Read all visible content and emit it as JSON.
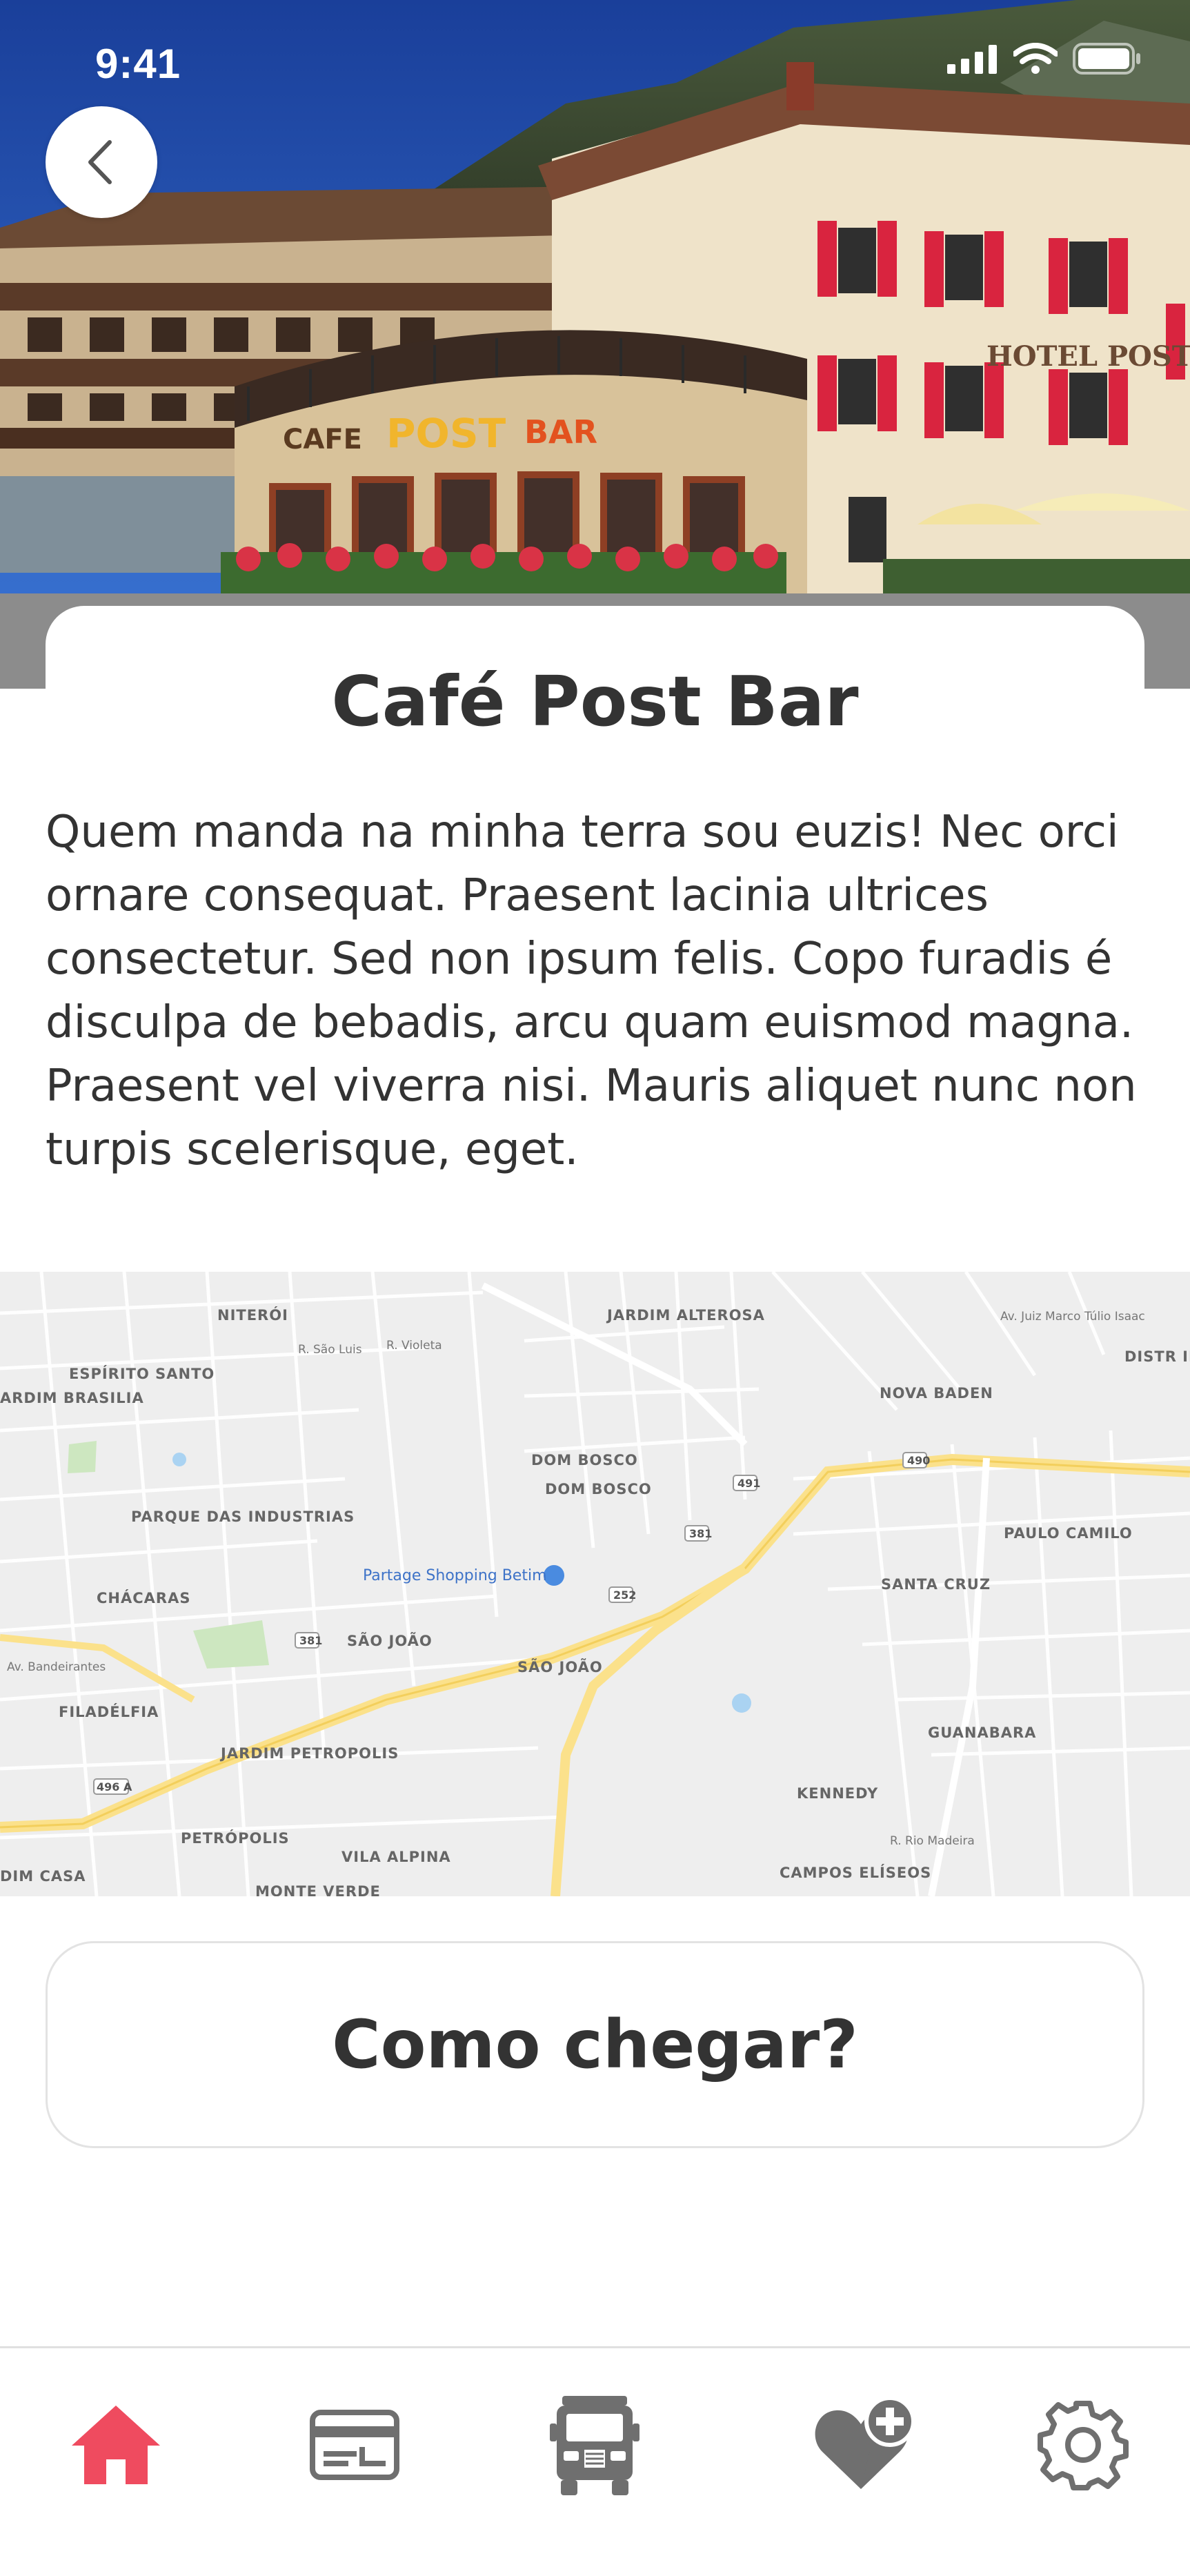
{
  "status_bar": {
    "time": "9:41",
    "icons": [
      "signal-icon",
      "wifi-icon",
      "battery-icon"
    ]
  },
  "header": {
    "back_icon": "chevron-left-icon"
  },
  "place": {
    "title": "Café Post Bar",
    "description": "Quem manda na minha terra sou euzis! Nec orci ornare consequat. Praesent lacinia ultrices consectetur. Sed non ipsum felis. Copo furadis é disculpa de bebadis, arcu quam euismod magna. Praesent vel viverra nisi. Mauris aliquet nunc non turpis scelerisque, eget.",
    "photo_signs": {
      "cafe_sign": "CAFE",
      "post_sign": "POST",
      "bar_sign": "BAR",
      "hotel_sign": "HOTEL POST"
    }
  },
  "map": {
    "labels": {
      "niteroi": "NITERÓI",
      "jardim_alterosa": "JARDIM ALTEROSA",
      "espirito_santo": "ESPÍRITO SANTO",
      "jardim_brasilia": "ARDIM BRASILIA",
      "nova_baden": "NOVA BADEN",
      "distr": "DISTR INDUST PAULO C NORT",
      "dom_bosco_1": "DOM BOSCO",
      "dom_bosco_2": "DOM BOSCO",
      "parque_industrias": "PARQUE DAS INDUSTRIAS",
      "paulo_camilo": "PAULO CAMILO",
      "partage": "Partage Shopping Betim",
      "santa_cruz": "SANTA CRUZ",
      "chacaras": "CHÁCARAS",
      "av_bandeirantes": "Av. Bandeirantes",
      "sao_joao_1": "SÃO JOÃO",
      "sao_joao_2": "SÃO JOÃO",
      "filadelfia": "FILADÉLFIA",
      "guanabara": "GUANABARA",
      "jardim_petropolis": "JARDIM PETROPOLIS",
      "kennedy": "KENNEDY",
      "petropolis": "PETRÓPOLIS",
      "vila_alpina": "VILA ALPINA",
      "campos_eliseos": "CAMPOS ELÍSEOS",
      "dim_casa": "DIM CASA",
      "monte_verde": "MONTE VERDE",
      "r_sao_luis": "R. São Luis",
      "r_violeta": "R. Violeta",
      "av_juiz": "Av. Juiz Marco Túlio Isaac",
      "r_rio_madeira": "R. Rio Madeira",
      "shield_491": "491",
      "shield_381a": "381",
      "shield_381b": "381",
      "shield_252": "252",
      "shield_490": "490",
      "shield_496a": "496 A"
    }
  },
  "actions": {
    "directions_label": "Como chegar?"
  },
  "tab_bar": {
    "items": [
      {
        "name": "home",
        "icon": "home-icon",
        "active": true
      },
      {
        "name": "card",
        "icon": "card-icon",
        "active": false
      },
      {
        "name": "truck",
        "icon": "truck-icon",
        "active": false
      },
      {
        "name": "favorites",
        "icon": "heart-plus-icon",
        "active": false
      },
      {
        "name": "settings",
        "icon": "gear-icon",
        "active": false
      }
    ]
  },
  "colors": {
    "accent": "#ef4b5f",
    "text": "#333333",
    "icon_inactive": "#6f6f6f",
    "map_road_major": "#fbe18b",
    "map_bg": "#eeeeee"
  }
}
